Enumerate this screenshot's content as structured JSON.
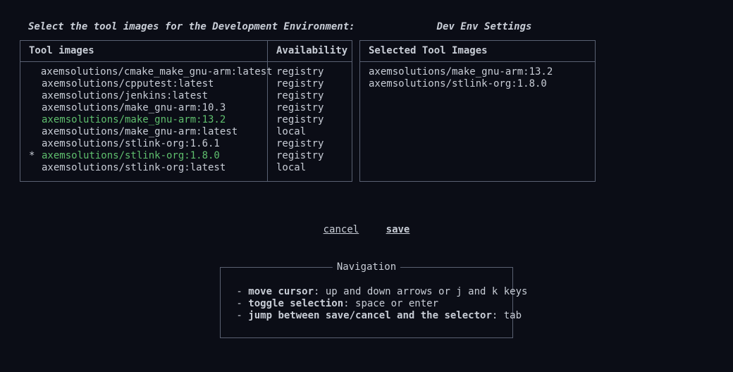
{
  "header": {
    "title": "Select the tool images for the Development Environment:",
    "right": "Dev Env Settings"
  },
  "columns": {
    "images_header": "Tool images",
    "avail_header": "Availability",
    "selected_header": "Selected Tool Images"
  },
  "tool_images": [
    {
      "name": "axemsolutions/cmake_make_gnu-arm:latest",
      "availability": "registry",
      "selected": false,
      "cursor": false
    },
    {
      "name": "axemsolutions/cpputest:latest",
      "availability": "registry",
      "selected": false,
      "cursor": false
    },
    {
      "name": "axemsolutions/jenkins:latest",
      "availability": "registry",
      "selected": false,
      "cursor": false
    },
    {
      "name": "axemsolutions/make_gnu-arm:10.3",
      "availability": "registry",
      "selected": false,
      "cursor": false
    },
    {
      "name": "axemsolutions/make_gnu-arm:13.2",
      "availability": "registry",
      "selected": true,
      "cursor": false
    },
    {
      "name": "axemsolutions/make_gnu-arm:latest",
      "availability": "local",
      "selected": false,
      "cursor": false
    },
    {
      "name": "axemsolutions/stlink-org:1.6.1",
      "availability": "registry",
      "selected": false,
      "cursor": false
    },
    {
      "name": "axemsolutions/stlink-org:1.8.0",
      "availability": "registry",
      "selected": true,
      "cursor": true
    },
    {
      "name": "axemsolutions/stlink-org:latest",
      "availability": "local",
      "selected": false,
      "cursor": false
    }
  ],
  "selected_list": [
    "axemsolutions/make_gnu-arm:13.2",
    "axemsolutions/stlink-org:1.8.0"
  ],
  "actions": {
    "cancel": "cancel",
    "save": "save"
  },
  "navigation": {
    "legend": "Navigation",
    "items": [
      {
        "key": "move cursor",
        "desc": ": up and down arrows or j and k keys"
      },
      {
        "key": "toggle selection",
        "desc": ": space or enter"
      },
      {
        "key": "jump between save/cancel and the selector",
        "desc": ": tab"
      }
    ]
  },
  "cursor_glyph": "*"
}
